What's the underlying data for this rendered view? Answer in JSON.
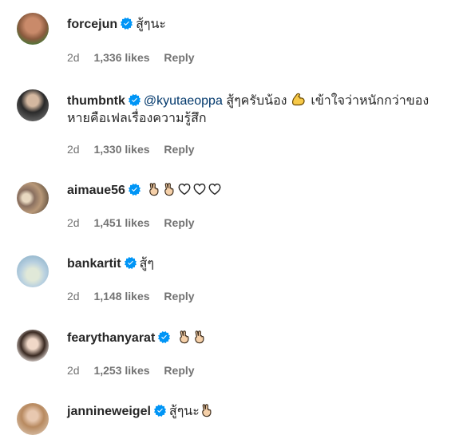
{
  "comments": [
    {
      "username": "forcejun",
      "mention": "",
      "text": "สู้ๆนะ",
      "text2": "",
      "time": "2d",
      "likes": "1,336 likes",
      "reply": "Reply"
    },
    {
      "username": "thumbntk",
      "mention": "@kyutaeoppa",
      "text": "สู้ๆครับน้อง",
      "text_after": "เข้าใจว่าหนักกว่าของ",
      "text2": "หายคือเฟลเรื่องความรู้สึก",
      "time": "2d",
      "likes": "1,330 likes",
      "reply": "Reply"
    },
    {
      "username": "aimaue56",
      "mention": "",
      "text": "",
      "text2": "",
      "time": "2d",
      "likes": "1,451 likes",
      "reply": "Reply"
    },
    {
      "username": "bankartit",
      "mention": "",
      "text": "สู้ๆ",
      "text2": "",
      "time": "2d",
      "likes": "1,148 likes",
      "reply": "Reply"
    },
    {
      "username": "fearythanyarat",
      "mention": "",
      "text": "",
      "text2": "",
      "time": "2d",
      "likes": "1,253 likes",
      "reply": "Reply"
    },
    {
      "username": "jannineweigel",
      "mention": "",
      "text": "สู้ๆนะ",
      "text2": "",
      "time": "",
      "likes": "",
      "reply": ""
    }
  ],
  "colors": {
    "verified": "#0095f6",
    "text": "#262626",
    "meta": "#737373",
    "mention": "#00376b"
  }
}
